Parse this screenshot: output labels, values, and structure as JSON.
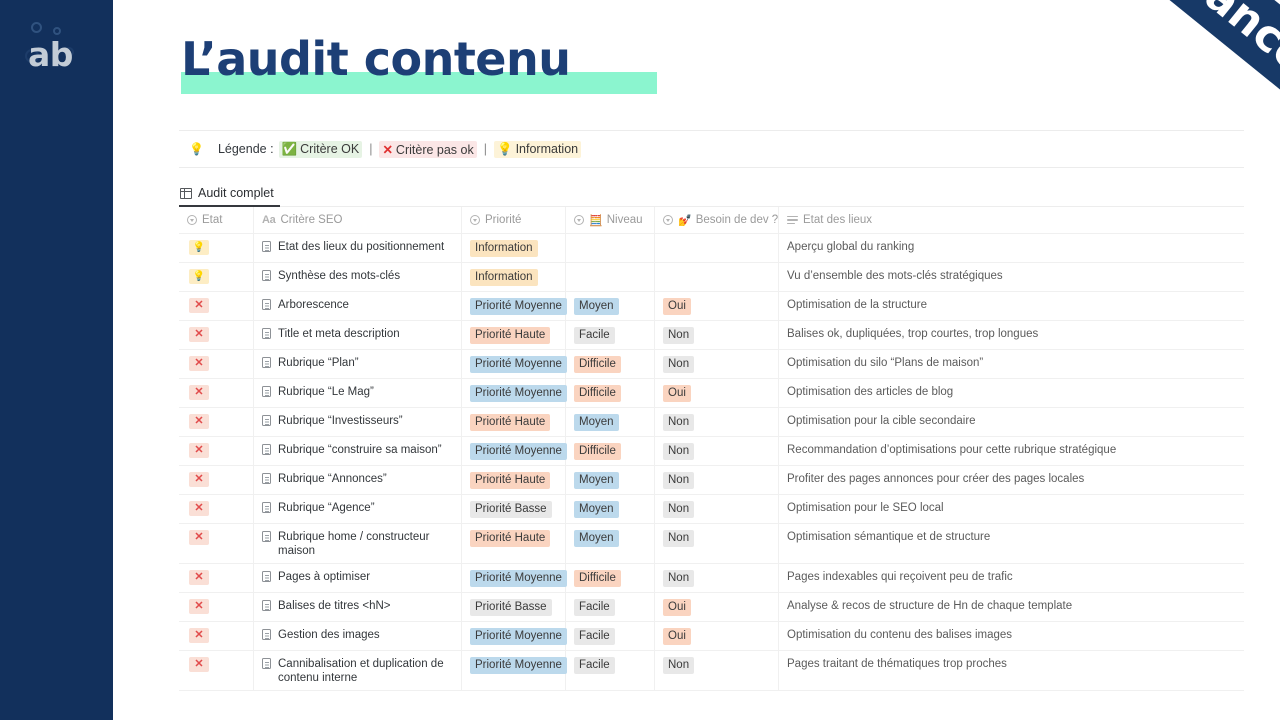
{
  "sidebar": {
    "logo_text": "ab"
  },
  "ribbon": {
    "label": "abondance"
  },
  "title": {
    "text": "L’audit contenu"
  },
  "legend": {
    "bulb_icon": "light-bulb",
    "label": "Légende :",
    "ok_mark": "✅",
    "ok_text": "Critère OK",
    "sep1": "|",
    "ko_mark": "✕",
    "ko_text": "Critère pas ok",
    "sep2": "|",
    "info_mark": "💡",
    "info_text": "Information"
  },
  "tabs": [
    {
      "label": "Audit complet",
      "icon": "table-icon",
      "active": true
    }
  ],
  "table": {
    "columns": [
      {
        "label": "Etat",
        "icon": "select-circle-icon"
      },
      {
        "label": "Critère SEO",
        "icon": "aa-text-icon"
      },
      {
        "label": "Priorité",
        "icon": "select-circle-icon"
      },
      {
        "label": "Niveau",
        "icon": "select-circle-icon",
        "emoji": "🧮"
      },
      {
        "label": "Besoin de dev ?",
        "icon": "select-circle-icon",
        "emoji": "💅"
      },
      {
        "label": "Etat des lieux",
        "icon": "text-lines-icon"
      }
    ],
    "rows": [
      {
        "etat": "💡",
        "etat_type": "info",
        "critere": "Etat des lieux du positionnement",
        "priorite": "Information",
        "priorite_style": "b-info",
        "niveau": "",
        "niveau_style": "",
        "dev": "",
        "dev_style": "",
        "etat_lieux": "Aperçu global du ranking"
      },
      {
        "etat": "💡",
        "etat_type": "info",
        "critere": "Synthèse des mots-clés",
        "priorite": "Information",
        "priorite_style": "b-info",
        "niveau": "",
        "niveau_style": "",
        "dev": "",
        "dev_style": "",
        "etat_lieux": "Vu d’ensemble des mots-clés stratégiques"
      },
      {
        "etat": "✕",
        "etat_type": "ko",
        "critere": "Arborescence",
        "priorite": "Priorité Moyenne",
        "priorite_style": "b-blue",
        "niveau": "Moyen",
        "niveau_style": "b-blue",
        "dev": "Oui",
        "dev_style": "b-orange",
        "etat_lieux": "Optimisation de la structure"
      },
      {
        "etat": "✕",
        "etat_type": "ko",
        "critere": "Title et meta description",
        "priorite": "Priorité Haute",
        "priorite_style": "b-orange",
        "niveau": "Facile",
        "niveau_style": "b-gray",
        "dev": "Non",
        "dev_style": "b-gray",
        "etat_lieux": "Balises ok, dupliquées, trop courtes, trop longues"
      },
      {
        "etat": "✕",
        "etat_type": "ko",
        "critere": "Rubrique “Plan”",
        "priorite": "Priorité Moyenne",
        "priorite_style": "b-blue",
        "niveau": "Difficile",
        "niveau_style": "b-orange",
        "dev": "Non",
        "dev_style": "b-gray",
        "etat_lieux": "Optimisation du silo “Plans de maison”"
      },
      {
        "etat": "✕",
        "etat_type": "ko",
        "critere": "Rubrique “Le Mag”",
        "priorite": "Priorité Moyenne",
        "priorite_style": "b-blue",
        "niveau": "Difficile",
        "niveau_style": "b-orange",
        "dev": "Oui",
        "dev_style": "b-orange",
        "etat_lieux": "Optimisation des articles de blog"
      },
      {
        "etat": "✕",
        "etat_type": "ko",
        "critere": "Rubrique “Investisseurs”",
        "priorite": "Priorité Haute",
        "priorite_style": "b-orange",
        "niveau": "Moyen",
        "niveau_style": "b-blue",
        "dev": "Non",
        "dev_style": "b-gray",
        "etat_lieux": "Optimisation pour la cible secondaire"
      },
      {
        "etat": "✕",
        "etat_type": "ko",
        "critere": "Rubrique “construire sa maison”",
        "priorite": "Priorité Moyenne",
        "priorite_style": "b-blue",
        "niveau": "Difficile",
        "niveau_style": "b-orange",
        "dev": "Non",
        "dev_style": "b-gray",
        "etat_lieux": "Recommandation d’optimisations pour cette rubrique stratégique"
      },
      {
        "etat": "✕",
        "etat_type": "ko",
        "critere": "Rubrique “Annonces”",
        "priorite": "Priorité Haute",
        "priorite_style": "b-orange",
        "niveau": "Moyen",
        "niveau_style": "b-blue",
        "dev": "Non",
        "dev_style": "b-gray",
        "etat_lieux": "Profiter des pages annonces pour créer des pages locales"
      },
      {
        "etat": "✕",
        "etat_type": "ko",
        "critere": "Rubrique “Agence”",
        "priorite": "Priorité Basse",
        "priorite_style": "b-gray",
        "niveau": "Moyen",
        "niveau_style": "b-blue",
        "dev": "Non",
        "dev_style": "b-gray",
        "etat_lieux": "Optimisation pour le SEO local"
      },
      {
        "etat": "✕",
        "etat_type": "ko",
        "critere": "Rubrique home / constructeur maison",
        "priorite": "Priorité Haute",
        "priorite_style": "b-orange",
        "niveau": "Moyen",
        "niveau_style": "b-blue",
        "dev": "Non",
        "dev_style": "b-gray",
        "etat_lieux": "Optimisation sémantique et de structure"
      },
      {
        "etat": "✕",
        "etat_type": "ko",
        "critere": "Pages à optimiser",
        "priorite": "Priorité Moyenne",
        "priorite_style": "b-blue",
        "niveau": "Difficile",
        "niveau_style": "b-orange",
        "dev": "Non",
        "dev_style": "b-gray",
        "etat_lieux": "Pages indexables qui reçoivent peu de trafic"
      },
      {
        "etat": "✕",
        "etat_type": "ko",
        "critere": "Balises de titres <hN>",
        "priorite": "Priorité Basse",
        "priorite_style": "b-gray",
        "niveau": "Facile",
        "niveau_style": "b-gray",
        "dev": "Oui",
        "dev_style": "b-orange",
        "etat_lieux": "Analyse & recos de structure de Hn de chaque template"
      },
      {
        "etat": "✕",
        "etat_type": "ko",
        "critere": "Gestion des images",
        "priorite": "Priorité Moyenne",
        "priorite_style": "b-blue",
        "niveau": "Facile",
        "niveau_style": "b-gray",
        "dev": "Oui",
        "dev_style": "b-orange",
        "etat_lieux": "Optimisation du contenu des balises images"
      },
      {
        "etat": "✕",
        "etat_type": "ko",
        "critere": "Cannibalisation et duplication de contenu interne",
        "priorite": "Priorité Moyenne",
        "priorite_style": "b-blue",
        "niveau": "Facile",
        "niveau_style": "b-gray",
        "dev": "Non",
        "dev_style": "b-gray",
        "etat_lieux": "Pages traitant de thématiques trop proches"
      }
    ]
  },
  "colors": {
    "sidebar_navy": "#12305c",
    "ribbon_navy": "#173967",
    "title_navy": "#1d3f76",
    "title_highlight": "#8bf5cf",
    "badge_blue": "#bcd9ec",
    "badge_orange": "#fad4c0",
    "badge_gray": "#e8e8e8",
    "badge_info": "#fbe4bf",
    "state_ko_bg": "#fadfd6",
    "state_info_bg": "#fdedc4"
  }
}
